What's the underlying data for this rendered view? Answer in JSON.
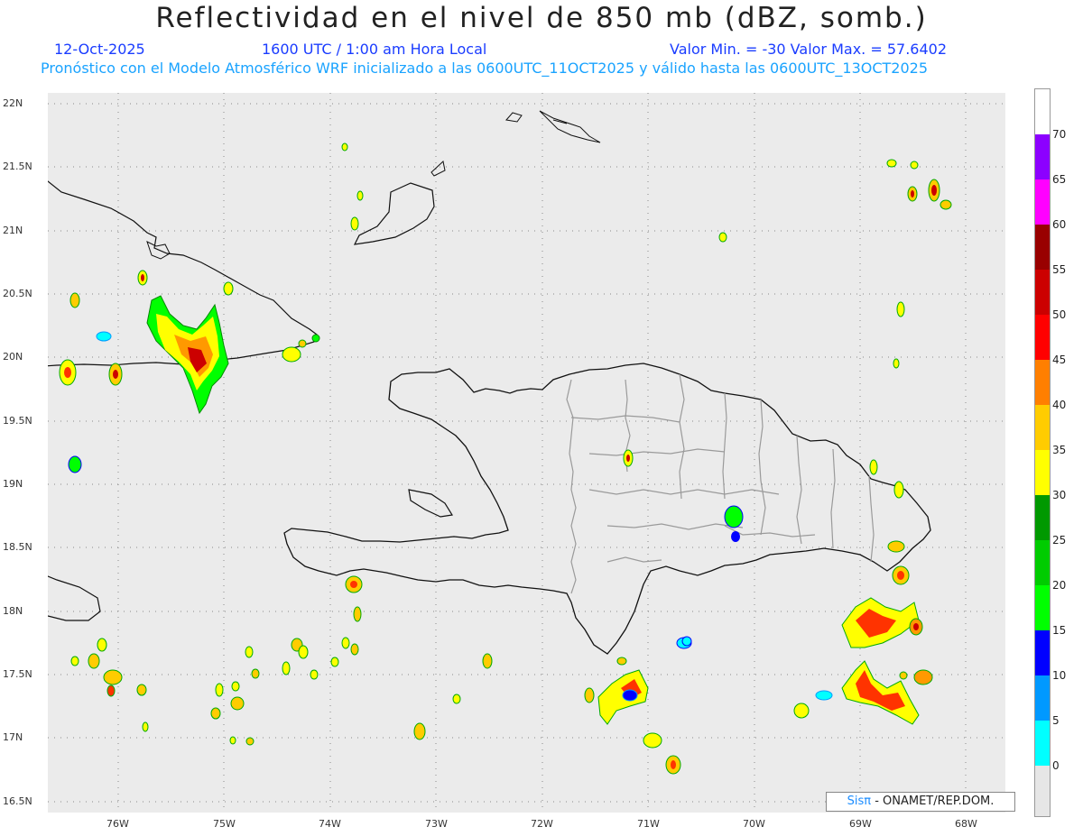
{
  "header": {
    "title": "Reflectividad en el nivel de 850 mb (dBZ, somb.)",
    "date": "12-Oct-2025",
    "time": "1600 UTC / 1:00 am Hora Local",
    "minmax": "Valor Min. = -30  Valor Max. = 57.6402",
    "model": "Pronóstico con el Modelo Atmosférico WRF inicializado a las 0600UTC_11OCT2025 y válido hasta las  0600UTC_13OCT2025"
  },
  "axes": {
    "lat_labels": [
      "22N",
      "21.5N",
      "21N",
      "20.5N",
      "20N",
      "19.5N",
      "19N",
      "18.5N",
      "18N",
      "17.5N",
      "17N",
      "16.5N"
    ],
    "lon_labels": [
      "76W",
      "75W",
      "74W",
      "73W",
      "72W",
      "71W",
      "70W",
      "69W",
      "68W"
    ]
  },
  "colorbar": {
    "labels": [
      "70",
      "65",
      "60",
      "55",
      "50",
      "45",
      "40",
      "35",
      "30",
      "25",
      "20",
      "15",
      "10",
      "5",
      "0"
    ],
    "colors": [
      "#8c00ff",
      "#ff00ff",
      "#990000",
      "#cc0000",
      "#ff0000",
      "#ff7f00",
      "#ffcc00",
      "#ffff00",
      "#009900",
      "#00cc00",
      "#00ff00",
      "#0000ff",
      "#0099ff",
      "#00ffff",
      "#ffffff",
      "#e6e6e6"
    ]
  },
  "credit": {
    "brand": "Sisπ",
    "text": "- ONAMET/REP.DOM."
  }
}
